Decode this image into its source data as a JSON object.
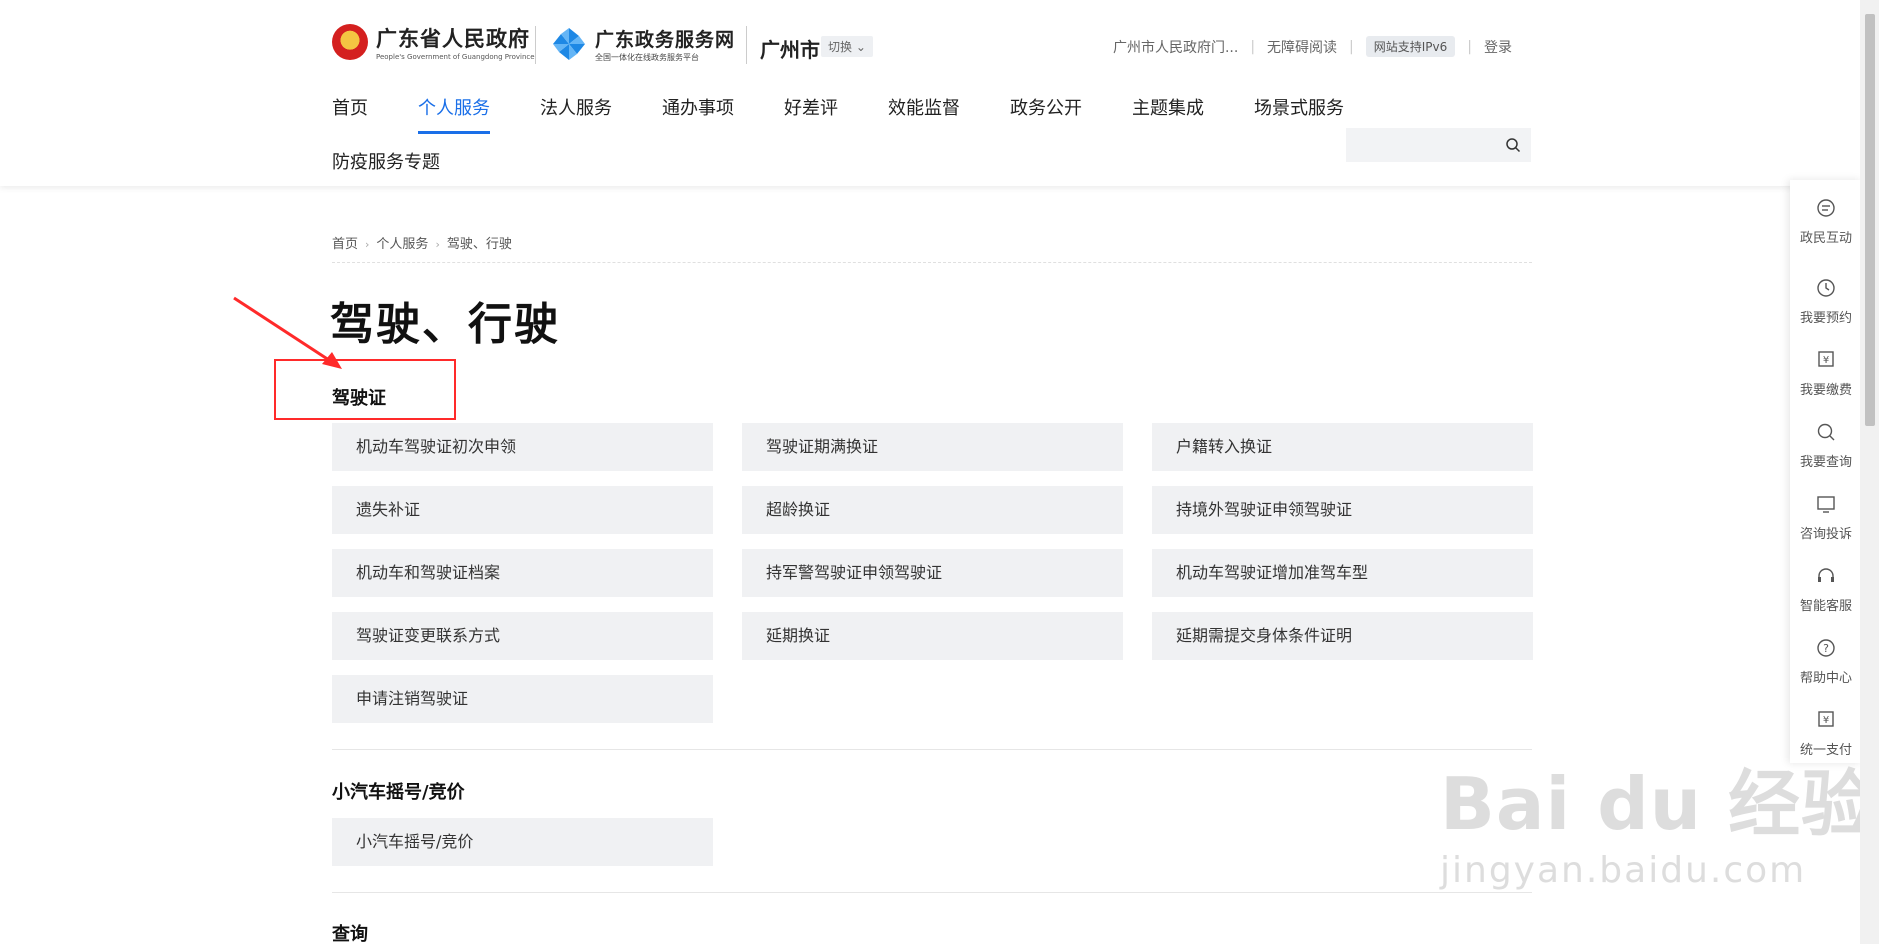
{
  "header": {
    "gov_name": "广东省人民政府",
    "gov_subtitle": "People's Government of Guangdong Province",
    "service_name": "广东政务服务网",
    "service_subtitle": "全国一体化在线政务服务平台",
    "city": "广州市",
    "switch_label": "切换",
    "links": {
      "city_portal": "广州市人民政府门...",
      "accessible": "无障碍阅读",
      "ipv6": "网站支持IPv6",
      "login": "登录"
    }
  },
  "nav": {
    "items": [
      "首页",
      "个人服务",
      "法人服务",
      "通办事项",
      "好差评",
      "效能监督",
      "政务公开",
      "主题集成",
      "场景式服务"
    ],
    "active_index": 1,
    "second_row": "防疫服务专题"
  },
  "breadcrumb": [
    "首页",
    "个人服务",
    "驾驶、行驶"
  ],
  "page_title": "驾驶、行驶",
  "sections": [
    {
      "title": "驾驶证",
      "items": [
        "机动车驾驶证初次申领",
        "驾驶证期满换证",
        "户籍转入换证",
        "遗失补证",
        "超龄换证",
        "持境外驾驶证申领驾驶证",
        "机动车和驾驶证档案",
        "持军警驾驶证申领驾驶证",
        "机动车驾驶证增加准驾车型",
        "驾驶证变更联系方式",
        "延期换证",
        "延期需提交身体条件证明",
        "申请注销驾驶证"
      ]
    },
    {
      "title": "小汽车摇号/竞价",
      "items": [
        "小汽车摇号/竞价"
      ]
    },
    {
      "title": "查询",
      "items": []
    }
  ],
  "sidebar": {
    "items": [
      "政民互动",
      "我要预约",
      "我要缴费",
      "我要查询",
      "咨询投诉",
      "智能客服",
      "帮助中心",
      "统一支付"
    ]
  },
  "watermark": {
    "brand": "Bai du 经验",
    "url": "jingyan.baidu.com"
  },
  "colors": {
    "accent": "#1a6fe8",
    "annotation": "#ff2a2a",
    "tile_bg": "#f0f1f3"
  }
}
